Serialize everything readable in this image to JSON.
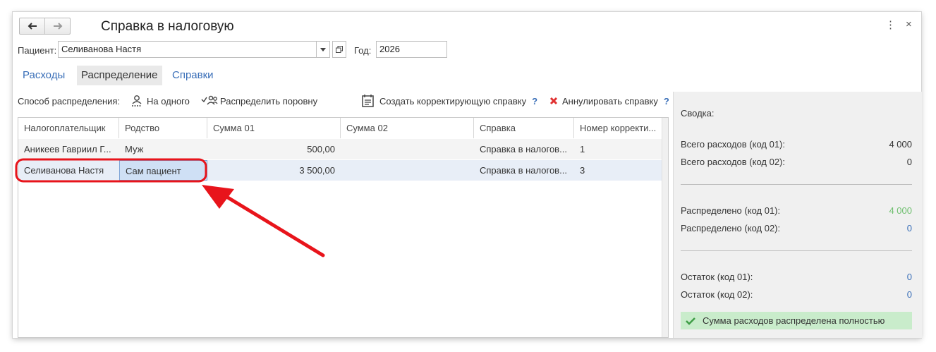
{
  "window": {
    "title": "Справка в налоговую",
    "more_icon": "⋮",
    "close_icon": "×"
  },
  "filters": {
    "patient_label": "Пациент:",
    "patient_value": "Селиванова Настя",
    "year_label": "Год:",
    "year_value": "2026"
  },
  "tabs": [
    {
      "label": "Расходы",
      "active": false
    },
    {
      "label": "Распределение",
      "active": true
    },
    {
      "label": "Справки",
      "active": false
    }
  ],
  "toolbar": {
    "method_label": "Способ распределения:",
    "to_one_label": "На одного",
    "evenly_label": "Распределить поровну",
    "create_correction_label": "Создать корректирующую справку",
    "help1": "?",
    "cancel_label": "Аннулировать справку",
    "help2": "?"
  },
  "table": {
    "columns": [
      "Налогоплательщик",
      "Родство",
      "Сумма 01",
      "Сумма 02",
      "Справка",
      "Номер корректи..."
    ],
    "rows": [
      [
        "Аникеев Гавриил Г...",
        "Муж",
        "500,00",
        "",
        "Справка в налогов...",
        "1"
      ],
      [
        "Селиванова Настя",
        "Сам пациент",
        "3 500,00",
        "",
        "Справка в налогов...",
        "3"
      ]
    ]
  },
  "summary": {
    "title": "Сводка:",
    "total01_label": "Всего расходов (код 01):",
    "total01_value": "4 000",
    "total02_label": "Всего расходов (код 02):",
    "total02_value": "0",
    "dist01_label": "Распределено (код 01):",
    "dist01_value": "4 000",
    "dist02_label": "Распределено (код 02):",
    "dist02_value": "0",
    "rest01_label": "Остаток (код 01):",
    "rest01_value": "0",
    "rest02_label": "Остаток (код 02):",
    "rest02_value": "0",
    "status_text": "Сумма расходов распределена полностью"
  },
  "colors": {
    "accent_blue": "#3a6fb8",
    "green_value": "#6fbf6f",
    "highlight_red": "#e8141b",
    "status_bg": "#c9eccb"
  }
}
